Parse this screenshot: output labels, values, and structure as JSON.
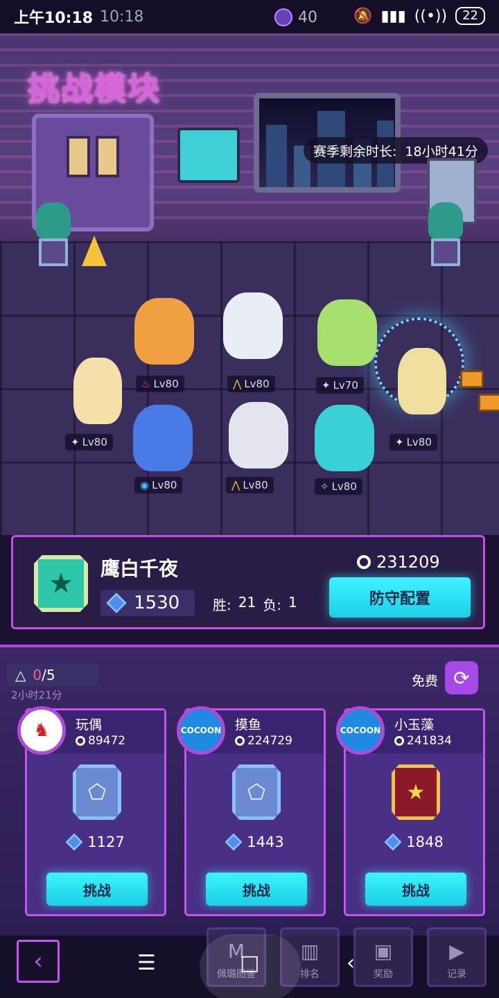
{
  "status_bar": {
    "time": "上午10:18",
    "time_ghost": "10:18",
    "coin_count": "40",
    "battery": "22"
  },
  "scene": {
    "neon_sign": "挑战模块",
    "season_label": "赛季剩余时长:",
    "season_value": "18小时41分"
  },
  "heroes": [
    {
      "level": "Lv80",
      "icon": "fire-icon"
    },
    {
      "level": "Lv80",
      "icon": "claw-icon"
    },
    {
      "level": "Lv70",
      "icon": "star-icon"
    },
    {
      "level": "Lv80",
      "icon": "star-icon"
    },
    {
      "level": "Lv80",
      "icon": "swirl-icon"
    },
    {
      "level": "Lv80",
      "icon": "claw-icon"
    },
    {
      "level": "Lv80",
      "icon": "shuriken-icon"
    },
    {
      "level": "Lv80",
      "icon": "star-icon"
    }
  ],
  "player": {
    "name": "鹰白千夜",
    "rating": "1530",
    "win_label": "胜:",
    "wins": "21",
    "loss_label": "负:",
    "losses": "1",
    "coins": "231209",
    "defense_button": "防守配置"
  },
  "challenge": {
    "attempts_current": "0",
    "attempts_total": "/5",
    "refresh_time": "2小时21分",
    "free_label": "免费"
  },
  "opponents": [
    {
      "name": "玩偶",
      "coins": "89472",
      "rating": "1127",
      "button": "挑战",
      "avatar": "doll"
    },
    {
      "name": "摸鱼",
      "coins": "224729",
      "rating": "1443",
      "button": "挑战",
      "avatar": "COCOON"
    },
    {
      "name": "小玉藻",
      "coins": "241834",
      "rating": "1848",
      "button": "挑战",
      "avatar": "COCOON"
    }
  ],
  "nav": {
    "items": [
      "佩璐图鉴",
      "排名",
      "奖励",
      "记录"
    ]
  },
  "colors": {
    "accent_cyan": "#3df3ff",
    "accent_magenta": "#c455f0",
    "panel_purple": "#2a1e48"
  }
}
